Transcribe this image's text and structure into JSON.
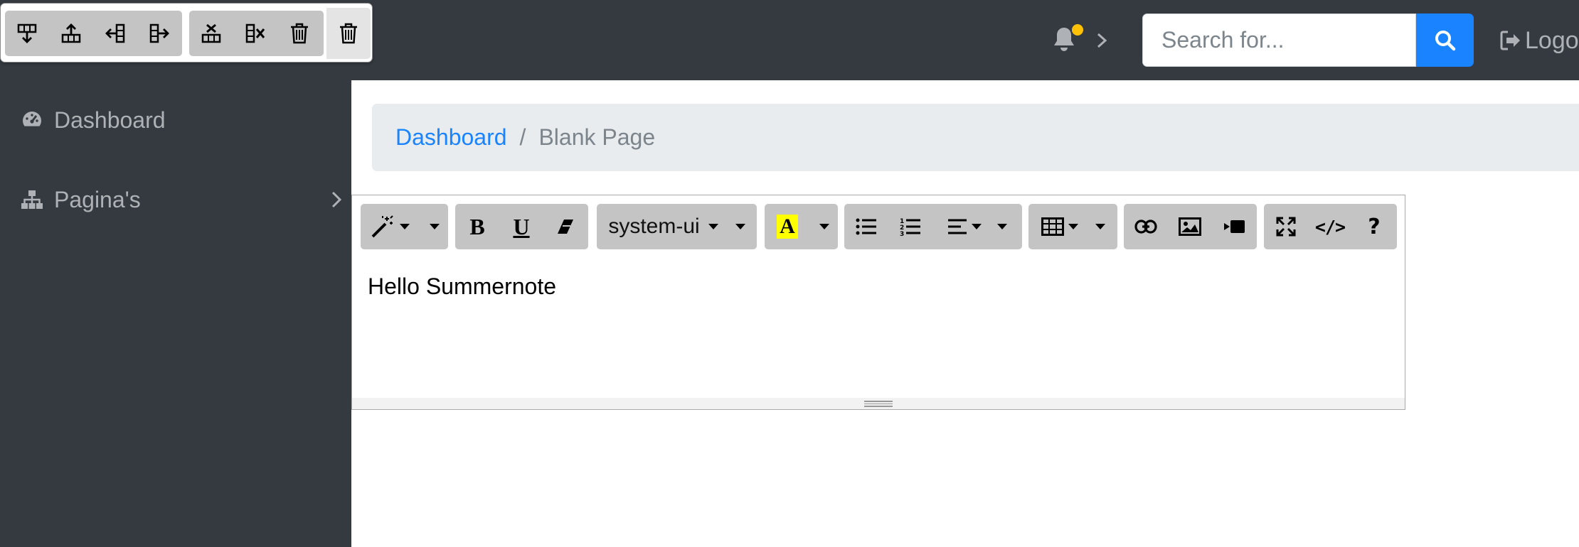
{
  "navbar": {
    "search_placeholder": "Search for...",
    "logout_label": "Logout"
  },
  "sidebar": {
    "items": [
      {
        "label": "Dashboard",
        "icon": "tachometer-icon"
      },
      {
        "label": "Pagina's",
        "icon": "sitemap-icon"
      }
    ]
  },
  "breadcrumb": {
    "items": [
      "Dashboard",
      "Blank Page"
    ],
    "separator": "/"
  },
  "editor": {
    "font_name": "system-ui",
    "highlight_letter": "A",
    "content": "Hello Summernote"
  },
  "table_popover": {
    "buttons": [
      "add-row-down-icon",
      "add-row-up-icon",
      "add-col-left-icon",
      "add-col-right-icon",
      "delete-row-icon",
      "delete-col-icon",
      "delete-table-icon"
    ]
  },
  "colors": {
    "navbar_bg": "#343a40",
    "primary": "#1a83ff",
    "toolbar_btn": "#c4c4c4",
    "notification_dot": "#ffc107",
    "highlight": "#ffff00"
  }
}
